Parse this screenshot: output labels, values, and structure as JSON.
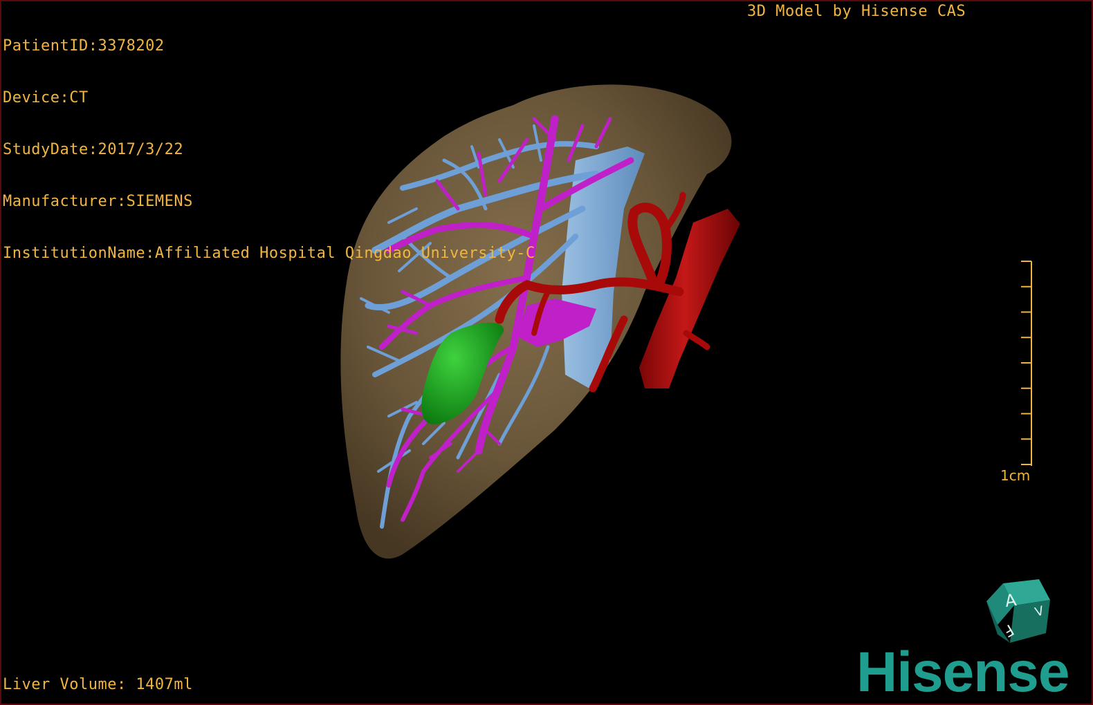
{
  "study_info": {
    "patient_id": "PatientID:3378202",
    "device": "Device:CT",
    "study_date": "StudyDate:2017/3/22",
    "manufacturer": "Manufacturer:SIEMENS",
    "institution": "InstitutionName:Affiliated Hospital Qingdao University-C"
  },
  "model_credit": "3D Model by Hisense CAS",
  "liver_volume": "Liver Volume: 1407ml",
  "scale": {
    "label": "1cm",
    "tick_count": 9
  },
  "orientation_cube": {
    "face_top": "A",
    "face_side": "V",
    "face_bottom": "F"
  },
  "brand": "Hisense",
  "colors": {
    "overlay_text": "#f2b640",
    "liver": "#6e5a3c",
    "hepatic_vein": "#6e9fd6",
    "portal_vein": "#c020c8",
    "artery": "#a80a0a",
    "gallbladder": "#16a61a",
    "brand": "#1f9e8f"
  }
}
